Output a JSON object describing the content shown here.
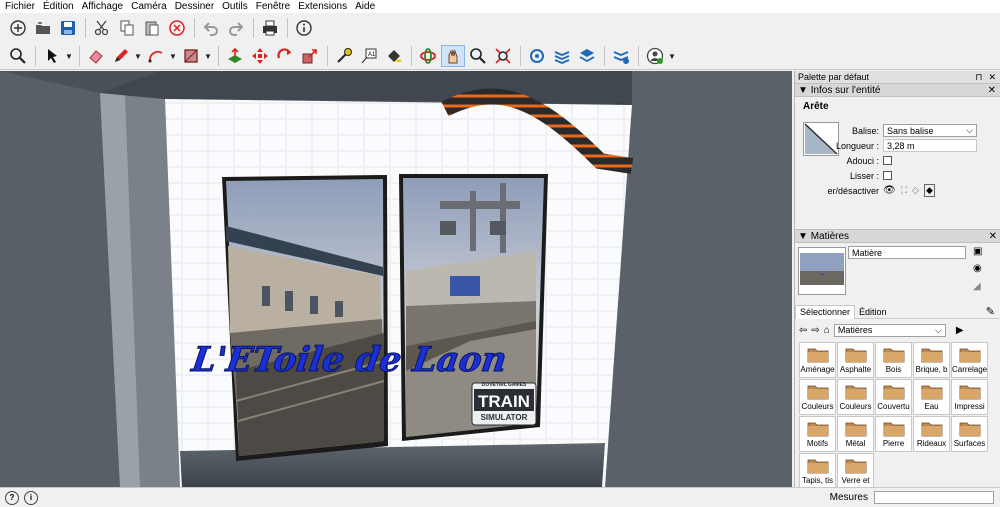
{
  "menu": [
    "Fichier",
    "Édition",
    "Affichage",
    "Caméra",
    "Dessiner",
    "Outils",
    "Fenêtre",
    "Extensions",
    "Aide"
  ],
  "toolbar1": [
    {
      "name": "new-icon"
    },
    {
      "name": "open-icon"
    },
    {
      "name": "save-icon"
    },
    {
      "name": "cut-icon"
    },
    {
      "name": "copy-icon"
    },
    {
      "name": "paste-icon"
    },
    {
      "name": "erase-selection-icon"
    },
    {
      "name": "undo-icon"
    },
    {
      "name": "redo-icon"
    },
    {
      "name": "print-icon"
    },
    {
      "name": "model-info-icon"
    }
  ],
  "toolbar2": [
    {
      "name": "zoom-window-icon"
    },
    {
      "name": "select-icon"
    },
    {
      "name": "eraser-icon"
    },
    {
      "name": "pencil-icon"
    },
    {
      "name": "arc-icon"
    },
    {
      "name": "rectangle-icon"
    },
    {
      "name": "push-pull-icon"
    },
    {
      "name": "move-icon"
    },
    {
      "name": "rotate-icon"
    },
    {
      "name": "scale-icon"
    },
    {
      "name": "tape-measure-icon"
    },
    {
      "name": "text-icon"
    },
    {
      "name": "paint-bucket-icon"
    },
    {
      "name": "orbit-icon"
    },
    {
      "name": "pan-icon"
    },
    {
      "name": "zoom-icon"
    },
    {
      "name": "zoom-extents-icon"
    },
    {
      "name": "warehouse-icon"
    },
    {
      "name": "extension-warehouse-icon"
    },
    {
      "name": "layout-icon"
    },
    {
      "name": "extension-manager-icon"
    },
    {
      "name": "account-icon"
    }
  ],
  "viewport": {
    "poster_text": "L'EToile de Laon",
    "logo_top": "DOVETAIL GAMES",
    "logo_main": "TRAIN",
    "logo_sub": "SIMULATOR"
  },
  "panel": {
    "title": "Palette par défaut",
    "entity_section": "Infos sur l'entité",
    "entity_type": "Arête",
    "balise_label": "Balise:",
    "balise_value": "Sans balise",
    "length_label": "Longueur :",
    "length_value": "3,28 m",
    "soft_label": "Adouci :",
    "smooth_label": "Lisser :",
    "shadow_label": "er/désactiver",
    "materials_section": "Matières",
    "material_name": "Matière",
    "tab_select": "Sélectionner",
    "tab_edit": "Édition",
    "library_value": "Matières",
    "materials": [
      "Aménage",
      "Asphalte",
      "Bois",
      "Brique, b",
      "Carrelage",
      "Couleurs",
      "Couleurs",
      "Couvertu",
      "Eau",
      "Impressi",
      "Motifs",
      "Métal",
      "Pierre",
      "Rideaux",
      "Surfaces",
      "Tapis, tis",
      "Verre et"
    ]
  },
  "status": {
    "measures_label": "Mesures"
  },
  "colors": {
    "poster_text": "#1a2fd8",
    "accent": "#2a78d6"
  }
}
